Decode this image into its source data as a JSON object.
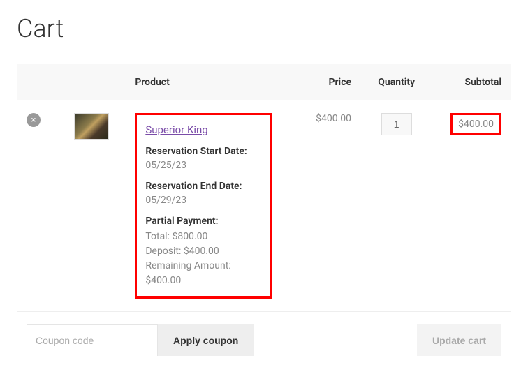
{
  "page": {
    "title": "Cart"
  },
  "headers": {
    "product": "Product",
    "price": "Price",
    "quantity": "Quantity",
    "subtotal": "Subtotal"
  },
  "item": {
    "remove_label": "×",
    "name": "Superior King",
    "price": "$400.00",
    "quantity": "1",
    "subtotal": "$400.00",
    "reservation_start_label": "Reservation Start Date:",
    "reservation_start_value": "05/25/23",
    "reservation_end_label": "Reservation End Date:",
    "reservation_end_value": "05/29/23",
    "partial_payment_label": "Partial Payment:",
    "partial_total": "Total: $800.00",
    "partial_deposit": "Deposit: $400.00",
    "partial_remaining": "Remaining Amount: $400.00"
  },
  "coupon": {
    "placeholder": "Coupon code",
    "apply_label": "Apply coupon"
  },
  "update_label": "Update cart"
}
